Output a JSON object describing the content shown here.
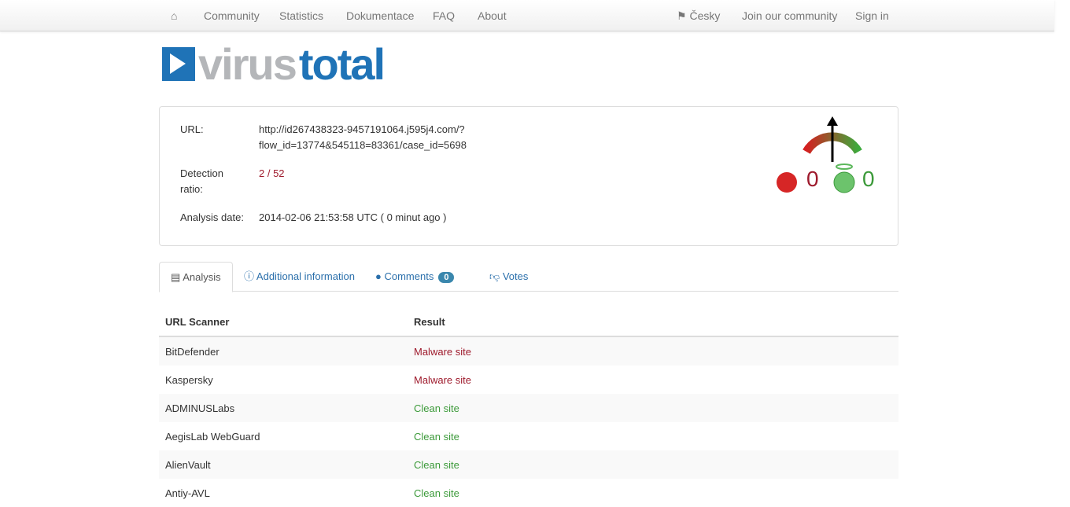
{
  "nav": {
    "home_icon": "home-icon",
    "left": [
      "Community",
      "Statistics",
      "Dokumentace",
      "FAQ",
      "About"
    ],
    "lang": "Česky",
    "join": "Join our community",
    "signin": "Sign in"
  },
  "logo": {
    "part1": "virus",
    "part2": "total"
  },
  "summary": {
    "url_label": "URL:",
    "url_line1": "http://id267438323-9457191064.j595j4.com/?",
    "url_line2": "flow_id=13774&545118=83361/case_id=5698",
    "ratio_label": "Detection ratio:",
    "ratio": "2 / 52",
    "date_label": "Analysis date:",
    "date": "2014-02-06 21:53:58 UTC ( 0 minut ago )",
    "votes_bad": "0",
    "votes_good": "0"
  },
  "tabs": {
    "analysis": "Analysis",
    "info": "Additional information",
    "comments": "Comments",
    "comments_count": "0",
    "votes": "Votes"
  },
  "table": {
    "headers": [
      "URL Scanner",
      "Result"
    ],
    "rows": [
      [
        "BitDefender",
        "Malware site"
      ],
      [
        "Kaspersky",
        "Malware site"
      ],
      [
        "ADMINUSLabs",
        "Clean site"
      ],
      [
        "AegisLab WebGuard",
        "Clean site"
      ],
      [
        "AlienVault",
        "Clean site"
      ],
      [
        "Antiy-AVL",
        "Clean site"
      ]
    ]
  },
  "colors": {
    "malware": "#9e1a2c",
    "clean": "#3c9a3a",
    "brand": "#1f73b7"
  }
}
